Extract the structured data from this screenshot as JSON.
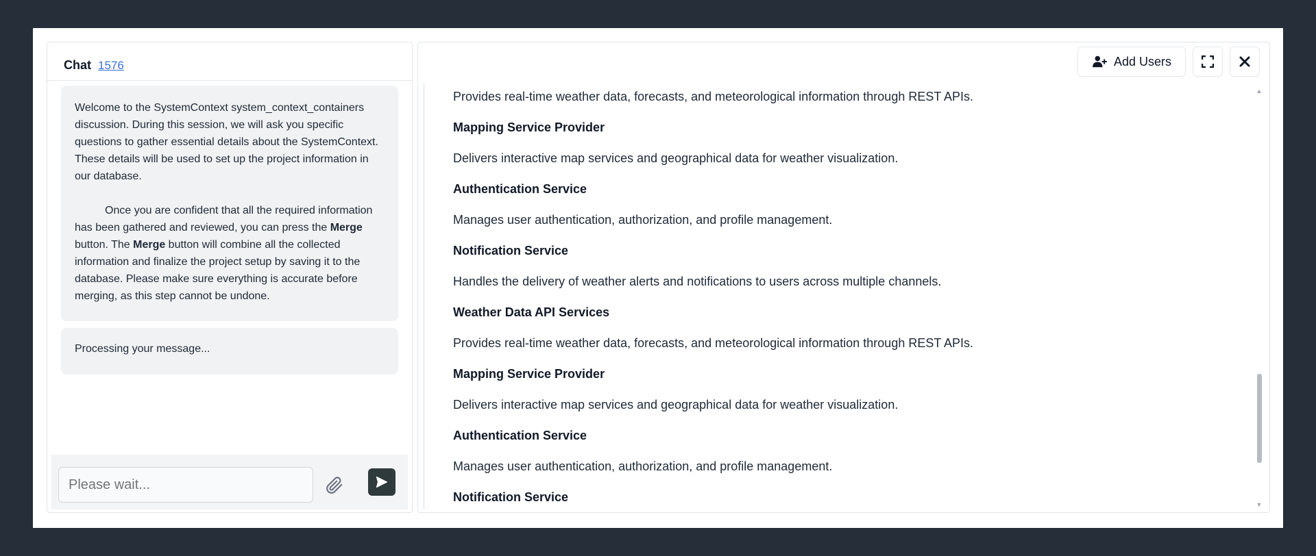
{
  "chat": {
    "title": "Chat",
    "id": "1576",
    "messages": {
      "welcome_p1": "Welcome to the SystemContext system_context_containers discussion. During this session, we will ask you specific questions to gather essential details about the SystemContext. These details will be used to set up the project information in our database.",
      "welcome_p2_a": "Once you are confident that all the required information has been gathered and reviewed, you can press the ",
      "merge_word": "Merge",
      "welcome_p2_b": " button. The ",
      "welcome_p2_c": " button will combine all the collected information and finalize the project setup by saving it to the database. Please make sure everything is accurate before merging, as this step cannot be undone.",
      "processing": "Processing your message..."
    },
    "input": {
      "placeholder": "Please wait..."
    }
  },
  "toolbar": {
    "add_users_label": "Add Users"
  },
  "document": {
    "items": [
      {
        "type": "text",
        "text": "Provides real-time weather data, forecasts, and meteorological information through REST APIs."
      },
      {
        "type": "heading",
        "text": "Mapping Service Provider"
      },
      {
        "type": "text",
        "text": "Delivers interactive map services and geographical data for weather visualization."
      },
      {
        "type": "heading",
        "text": "Authentication Service"
      },
      {
        "type": "text",
        "text": "Manages user authentication, authorization, and profile management."
      },
      {
        "type": "heading",
        "text": "Notification Service"
      },
      {
        "type": "text",
        "text": "Handles the delivery of weather alerts and notifications to users across multiple channels."
      },
      {
        "type": "heading",
        "text": "Weather Data API Services"
      },
      {
        "type": "text",
        "text": "Provides real-time weather data, forecasts, and meteorological information through REST APIs."
      },
      {
        "type": "heading",
        "text": "Mapping Service Provider"
      },
      {
        "type": "text",
        "text": "Delivers interactive map services and geographical data for weather visualization."
      },
      {
        "type": "heading",
        "text": "Authentication Service"
      },
      {
        "type": "text",
        "text": "Manages user authentication, authorization, and profile management."
      },
      {
        "type": "heading",
        "text": "Notification Service"
      }
    ]
  },
  "icons": {
    "add_user": "user-plus-icon",
    "expand": "expand-icon",
    "close": "close-icon",
    "attach": "paperclip-icon",
    "send": "send-icon"
  }
}
